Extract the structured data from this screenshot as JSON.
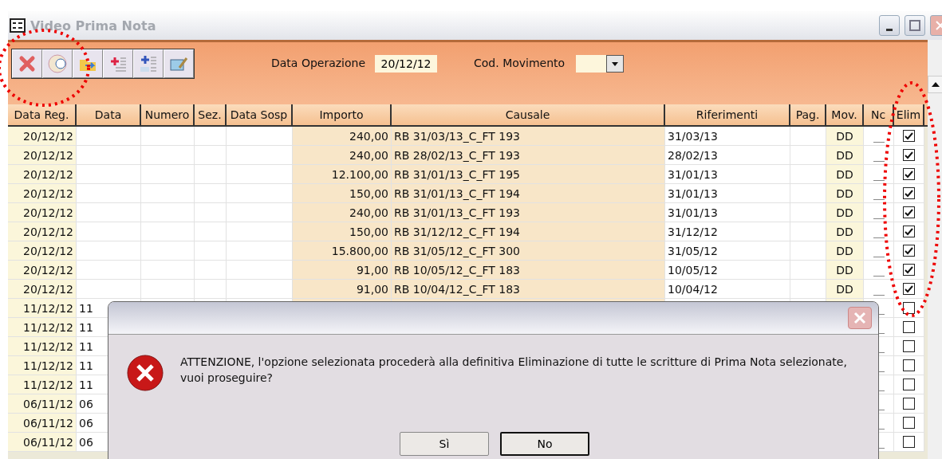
{
  "window": {
    "title": "Video Prima Nota"
  },
  "toolbar": {
    "date_label": "Data Operazione",
    "date_value": "20/12/12",
    "movement_label": "Cod. Movimento"
  },
  "table": {
    "columns": [
      "Data Reg.",
      "Data",
      "Numero",
      "Sez.",
      "Data Sosp",
      "Importo",
      "Causale",
      "Riferimenti",
      "Pag.",
      "Mov.",
      "Nc",
      "Elim"
    ],
    "rows": [
      {
        "data_reg": "20/12/12",
        "importo": "240,00",
        "causale": "RB 31/03/13_C_FT 193",
        "riferimenti": "31/03/13",
        "mov": "DD",
        "elim": true
      },
      {
        "data_reg": "20/12/12",
        "importo": "240,00",
        "causale": "RB 28/02/13_C_FT 193",
        "riferimenti": "28/02/13",
        "mov": "DD",
        "elim": true
      },
      {
        "data_reg": "20/12/12",
        "importo": "12.100,00",
        "causale": "RB 31/01/13_C_FT 195",
        "riferimenti": "31/01/13",
        "mov": "DD",
        "elim": true
      },
      {
        "data_reg": "20/12/12",
        "importo": "150,00",
        "causale": "RB 31/01/13_C_FT 194",
        "riferimenti": "31/01/13",
        "mov": "DD",
        "elim": true
      },
      {
        "data_reg": "20/12/12",
        "importo": "240,00",
        "causale": "RB 31/01/13_C_FT 193",
        "riferimenti": "31/01/13",
        "mov": "DD",
        "elim": true
      },
      {
        "data_reg": "20/12/12",
        "importo": "150,00",
        "causale": "RB 31/12/12_C_FT 194",
        "riferimenti": "31/12/12",
        "mov": "DD",
        "elim": true
      },
      {
        "data_reg": "20/12/12",
        "importo": "15.800,00",
        "causale": "RB 31/05/12_C_FT 300",
        "riferimenti": "31/05/12",
        "mov": "DD",
        "elim": true
      },
      {
        "data_reg": "20/12/12",
        "importo": "91,00",
        "causale": "RB 10/05/12_C_FT 183",
        "riferimenti": "10/05/12",
        "mov": "DD",
        "elim": true
      },
      {
        "data_reg": "20/12/12",
        "importo": "91,00",
        "causale": "RB 10/04/12_C_FT 183",
        "riferimenti": "10/04/12",
        "mov": "DD",
        "elim": true
      },
      {
        "data_reg": "11/12/12",
        "data": "11",
        "elim": false
      },
      {
        "data_reg": "11/12/12",
        "data": "11",
        "elim": false
      },
      {
        "data_reg": "11/12/12",
        "data": "11",
        "elim": false
      },
      {
        "data_reg": "11/12/12",
        "data": "11",
        "elim": false
      },
      {
        "data_reg": "11/12/12",
        "data": "11",
        "elim": false
      },
      {
        "data_reg": "06/11/12",
        "data": "06",
        "elim": false
      },
      {
        "data_reg": "06/11/12",
        "data": "06",
        "elim": false
      },
      {
        "data_reg": "06/11/12",
        "data": "06",
        "elim": false
      }
    ]
  },
  "dialog": {
    "message": "ATTENZIONE, l'opzione selezionata procederà alla definitiva Eliminazione di tutte le scritture di Prima Nota selezionate, vuoi proseguire?",
    "buttons": [
      {
        "label": "Sì",
        "selected": false
      },
      {
        "label": "No",
        "selected": true
      }
    ]
  }
}
